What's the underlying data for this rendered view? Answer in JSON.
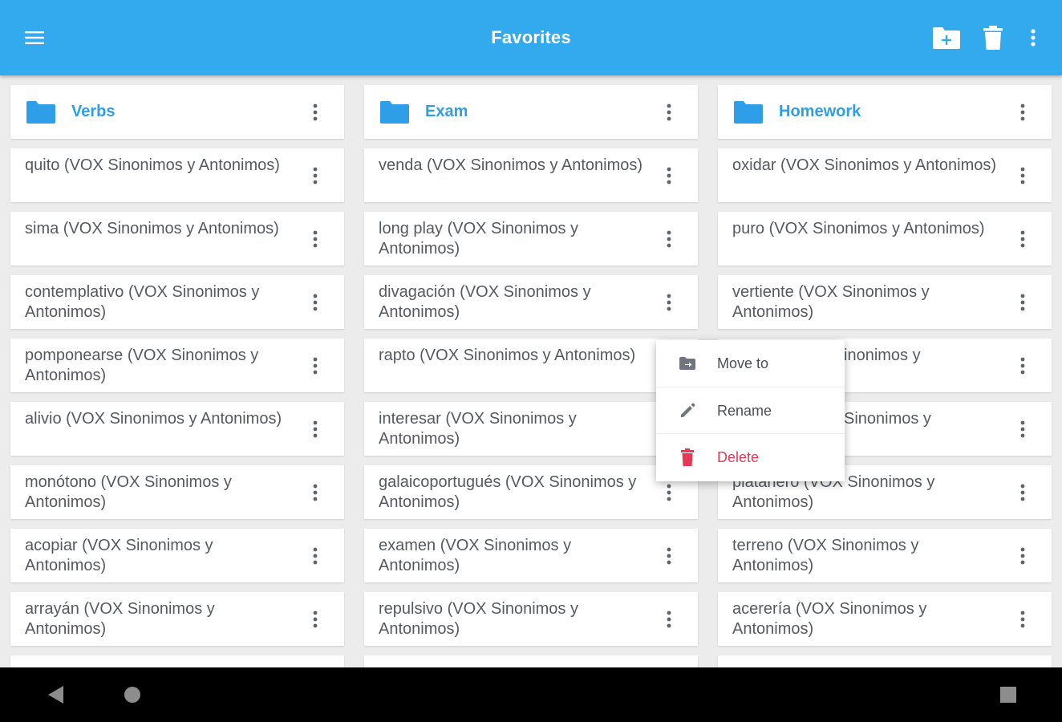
{
  "app_bar": {
    "title": "Favorites",
    "color": "#33a9ee",
    "icons": [
      "menu-icon",
      "new-folder-icon",
      "trash-icon",
      "more-vert-icon"
    ]
  },
  "columns": [
    {
      "folder": "Verbs",
      "items": [
        "quito (VOX Sinonimos y Antonimos)",
        "sima (VOX Sinonimos y Antonimos)",
        "contemplativo (VOX Sinonimos y Antonimos)",
        "pomponearse (VOX Sinonimos y Antonimos)",
        "alivio (VOX Sinonimos y Antonimos)",
        "monótono (VOX Sinonimos y Antonimos)",
        "acopiar (VOX Sinonimos y Antonimos)",
        "arrayán (VOX Sinonimos y Antonimos)"
      ]
    },
    {
      "folder": "Exam",
      "items": [
        "venda (VOX Sinonimos y Antonimos)",
        "long play (VOX Sinonimos y Antonimos)",
        "divagación (VOX Sinonimos y Antonimos)",
        "rapto (VOX Sinonimos y Antonimos)",
        "interesar (VOX Sinonimos y Antonimos)",
        "galaicoportugués (VOX Sinonimos y Antonimos)",
        "examen (VOX Sinonimos y Antonimos)",
        "repulsivo (VOX Sinonimos y Antonimos)"
      ]
    },
    {
      "folder": "Homework",
      "items": [
        "oxidar (VOX Sinonimos y Antonimos)",
        "puro (VOX Sinonimos y Antonimos)",
        "vertiente (VOX Sinonimos y Antonimos)",
        "inonimos y",
        "Sinonimos y",
        "platanero (VOX Sinonimos y Antonimos)",
        "terreno (VOX Sinonimos y Antonimos)",
        "acerería (VOX Sinonimos y Antonimos)"
      ]
    }
  ],
  "context_menu": {
    "items": [
      {
        "label": "Move to",
        "icon": "move-to-folder-icon"
      },
      {
        "label": "Rename",
        "icon": "pencil-icon"
      },
      {
        "label": "Delete",
        "icon": "trash-icon",
        "color": "#e53956"
      }
    ]
  },
  "nav_bar": {
    "icons": [
      "back-triangle-icon",
      "home-circle-icon",
      "recents-square-icon"
    ]
  },
  "colors": {
    "accent": "#33a9ee",
    "folder": "#2f9ee8",
    "item_text": "#555a5f",
    "danger": "#e53956"
  }
}
